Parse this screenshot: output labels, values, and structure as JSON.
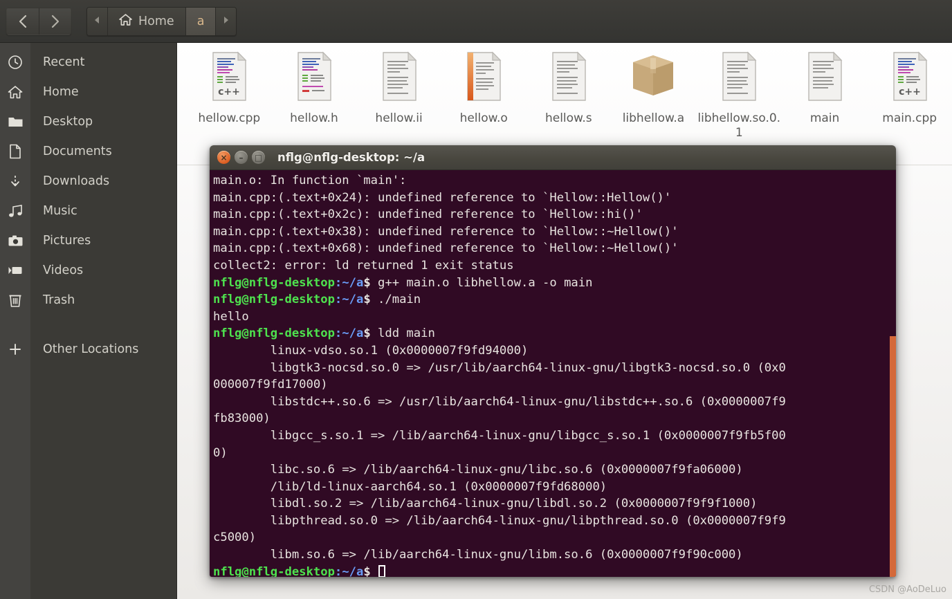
{
  "window": {
    "title": "a"
  },
  "toolbar": {
    "back_icon": "chevron-left-icon",
    "forward_icon": "chevron-right-icon",
    "crumb_prev_icon": "triangle-left-icon",
    "crumb_next_icon": "triangle-right-icon",
    "home_icon": "home-icon",
    "breadcrumbs": [
      {
        "label": "Home",
        "current": false
      },
      {
        "label": "a",
        "current": true
      }
    ]
  },
  "sidebar": {
    "items": [
      {
        "label": "Recent",
        "icon": "clock-icon"
      },
      {
        "label": "Home",
        "icon": "home-icon"
      },
      {
        "label": "Desktop",
        "icon": "folder-icon"
      },
      {
        "label": "Documents",
        "icon": "document-icon"
      },
      {
        "label": "Downloads",
        "icon": "download-arrow-icon"
      },
      {
        "label": "Music",
        "icon": "music-note-icon"
      },
      {
        "label": "Pictures",
        "icon": "camera-icon"
      },
      {
        "label": "Videos",
        "icon": "video-camera-icon"
      },
      {
        "label": "Trash",
        "icon": "trash-icon"
      },
      {
        "label": "Other Locations",
        "icon": "plus-icon"
      }
    ]
  },
  "files": [
    {
      "name": "hellow.cpp",
      "icon": "cpp-source-file-icon",
      "kind": "code"
    },
    {
      "name": "hellow.h",
      "icon": "header-source-file-icon",
      "kind": "code"
    },
    {
      "name": "hellow.ii",
      "icon": "text-file-icon",
      "kind": "text"
    },
    {
      "name": "hellow.o",
      "icon": "object-file-icon",
      "kind": "object"
    },
    {
      "name": "hellow.s",
      "icon": "text-file-icon",
      "kind": "text"
    },
    {
      "name": "libhellow.a",
      "icon": "archive-package-icon",
      "kind": "archive"
    },
    {
      "name": "libhellow.so.0.1",
      "icon": "text-file-icon",
      "kind": "text"
    },
    {
      "name": "main",
      "icon": "text-file-icon",
      "kind": "text"
    },
    {
      "name": "main.cpp",
      "icon": "cpp-source-file-icon",
      "kind": "code"
    }
  ],
  "terminal": {
    "title": "nflg@nflg-desktop: ~/a",
    "close_glyph": "×",
    "minimize_glyph": "–",
    "maximize_glyph": "□",
    "prompt_user": "nflg@nflg-desktop",
    "prompt_path": ":~/a",
    "prompt_sign": "$ ",
    "lines": [
      {
        "type": "out",
        "text": "main.o: In function `main':"
      },
      {
        "type": "out",
        "text": "main.cpp:(.text+0x24): undefined reference to `Hellow::Hellow()'"
      },
      {
        "type": "out",
        "text": "main.cpp:(.text+0x2c): undefined reference to `Hellow::hi()'"
      },
      {
        "type": "out",
        "text": "main.cpp:(.text+0x38): undefined reference to `Hellow::~Hellow()'"
      },
      {
        "type": "out",
        "text": "main.cpp:(.text+0x68): undefined reference to `Hellow::~Hellow()'"
      },
      {
        "type": "out",
        "text": "collect2: error: ld returned 1 exit status"
      },
      {
        "type": "cmd",
        "text": "g++ main.o libhellow.a -o main"
      },
      {
        "type": "cmd",
        "text": "./main"
      },
      {
        "type": "out",
        "text": "hello"
      },
      {
        "type": "cmd",
        "text": "ldd main"
      },
      {
        "type": "out",
        "text": "\tlinux-vdso.so.1 (0x0000007f9fd94000)"
      },
      {
        "type": "out",
        "text": "\tlibgtk3-nocsd.so.0 => /usr/lib/aarch64-linux-gnu/libgtk3-nocsd.so.0 (0x0"
      },
      {
        "type": "out",
        "text": "000007f9fd17000)"
      },
      {
        "type": "out",
        "text": "\tlibstdc++.so.6 => /usr/lib/aarch64-linux-gnu/libstdc++.so.6 (0x0000007f9"
      },
      {
        "type": "out",
        "text": "fb83000)"
      },
      {
        "type": "out",
        "text": "\tlibgcc_s.so.1 => /lib/aarch64-linux-gnu/libgcc_s.so.1 (0x0000007f9fb5f00"
      },
      {
        "type": "out",
        "text": "0)"
      },
      {
        "type": "out",
        "text": "\tlibc.so.6 => /lib/aarch64-linux-gnu/libc.so.6 (0x0000007f9fa06000)"
      },
      {
        "type": "out",
        "text": "\t/lib/ld-linux-aarch64.so.1 (0x0000007f9fd68000)"
      },
      {
        "type": "out",
        "text": "\tlibdl.so.2 => /lib/aarch64-linux-gnu/libdl.so.2 (0x0000007f9f9f1000)"
      },
      {
        "type": "out",
        "text": "\tlibpthread.so.0 => /lib/aarch64-linux-gnu/libpthread.so.0 (0x0000007f9f9"
      },
      {
        "type": "out",
        "text": "c5000)"
      },
      {
        "type": "out",
        "text": "\tlibm.so.6 => /lib/aarch64-linux-gnu/libm.so.6 (0x0000007f9f90c000)"
      },
      {
        "type": "prompt",
        "text": ""
      }
    ]
  },
  "watermark": {
    "text": "CSDN @AoDeLuo"
  },
  "colors": {
    "accent_orange": "#d4693a",
    "terminal_bg": "#300a24",
    "prompt_green": "#4ee24e",
    "prompt_blue": "#6a9cf6",
    "sidebar_bg": "#3b3a36"
  }
}
